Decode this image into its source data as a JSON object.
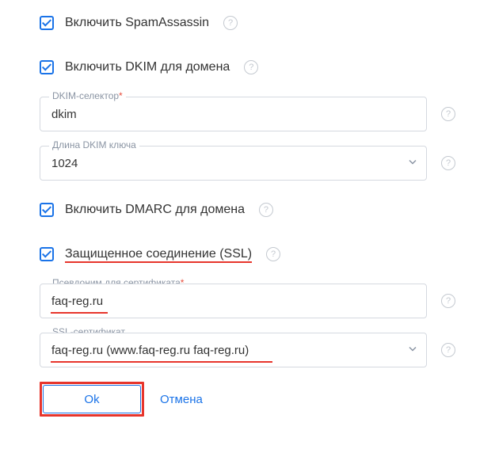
{
  "spam": {
    "label": "Включить SpamAssassin"
  },
  "dkim": {
    "label": "Включить DKIM для домена",
    "selector_label": "DKIM-селектор",
    "selector_value": "dkim",
    "keylen_label": "Длина DKIM ключа",
    "keylen_value": "1024"
  },
  "dmarc": {
    "label": "Включить DMARC для домена"
  },
  "ssl": {
    "label": "Защищенное соединение (SSL)",
    "alias_label": "Псевдоним для сертификата",
    "alias_value": "faq-reg.ru",
    "cert_label": "SSL-сертификат",
    "cert_value": "faq-reg.ru (www.faq-reg.ru faq-reg.ru)"
  },
  "buttons": {
    "ok": "Ok",
    "cancel": "Отмена"
  },
  "help_glyph": "?"
}
